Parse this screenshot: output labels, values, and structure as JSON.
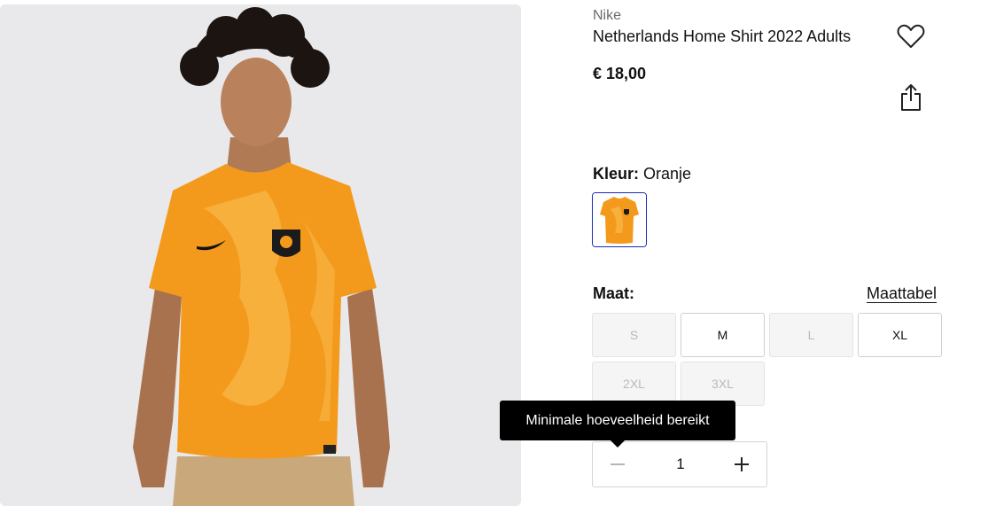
{
  "product": {
    "brand": "Nike",
    "title": "Netherlands Home Shirt 2022 Adults",
    "price": "€ 18,00"
  },
  "actions": {
    "wishlist_icon": "heart-outline-icon",
    "share_icon": "share-icon"
  },
  "color": {
    "label": "Kleur:",
    "value": "Oranje",
    "selected_swatch": "Oranje",
    "swatch_color": "#f39a1c"
  },
  "size": {
    "label": "Maat:",
    "guide_link": "Maattabel",
    "options": [
      {
        "label": "S",
        "available": false
      },
      {
        "label": "M",
        "available": true
      },
      {
        "label": "L",
        "available": false
      },
      {
        "label": "XL",
        "available": true
      },
      {
        "label": "2XL",
        "available": false
      },
      {
        "label": "3XL",
        "available": false
      }
    ]
  },
  "quantity": {
    "tooltip": "Minimale hoeveelheid bereikt",
    "value": "1",
    "minus_icon": "minus-icon",
    "plus_icon": "plus-icon"
  },
  "colors": {
    "accent_border": "#1a2bb8",
    "shirt_orange": "#f39a1c",
    "tooltip_bg": "#000000"
  }
}
